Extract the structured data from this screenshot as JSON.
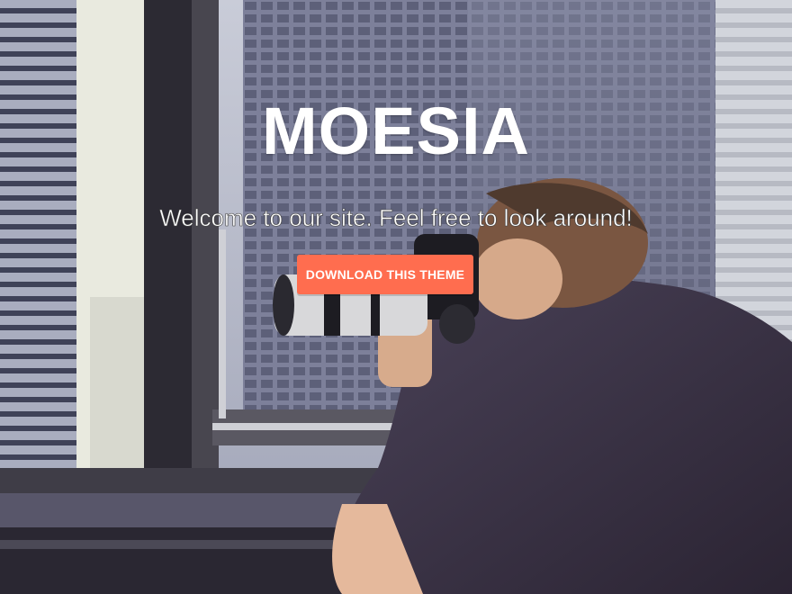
{
  "hero": {
    "title": "MOESIA",
    "description": "Welcome to our site. Feel free to look around!",
    "cta_label": "Download this theme"
  },
  "colors": {
    "accent": "#ff6d4f",
    "title": "#ffffff"
  }
}
